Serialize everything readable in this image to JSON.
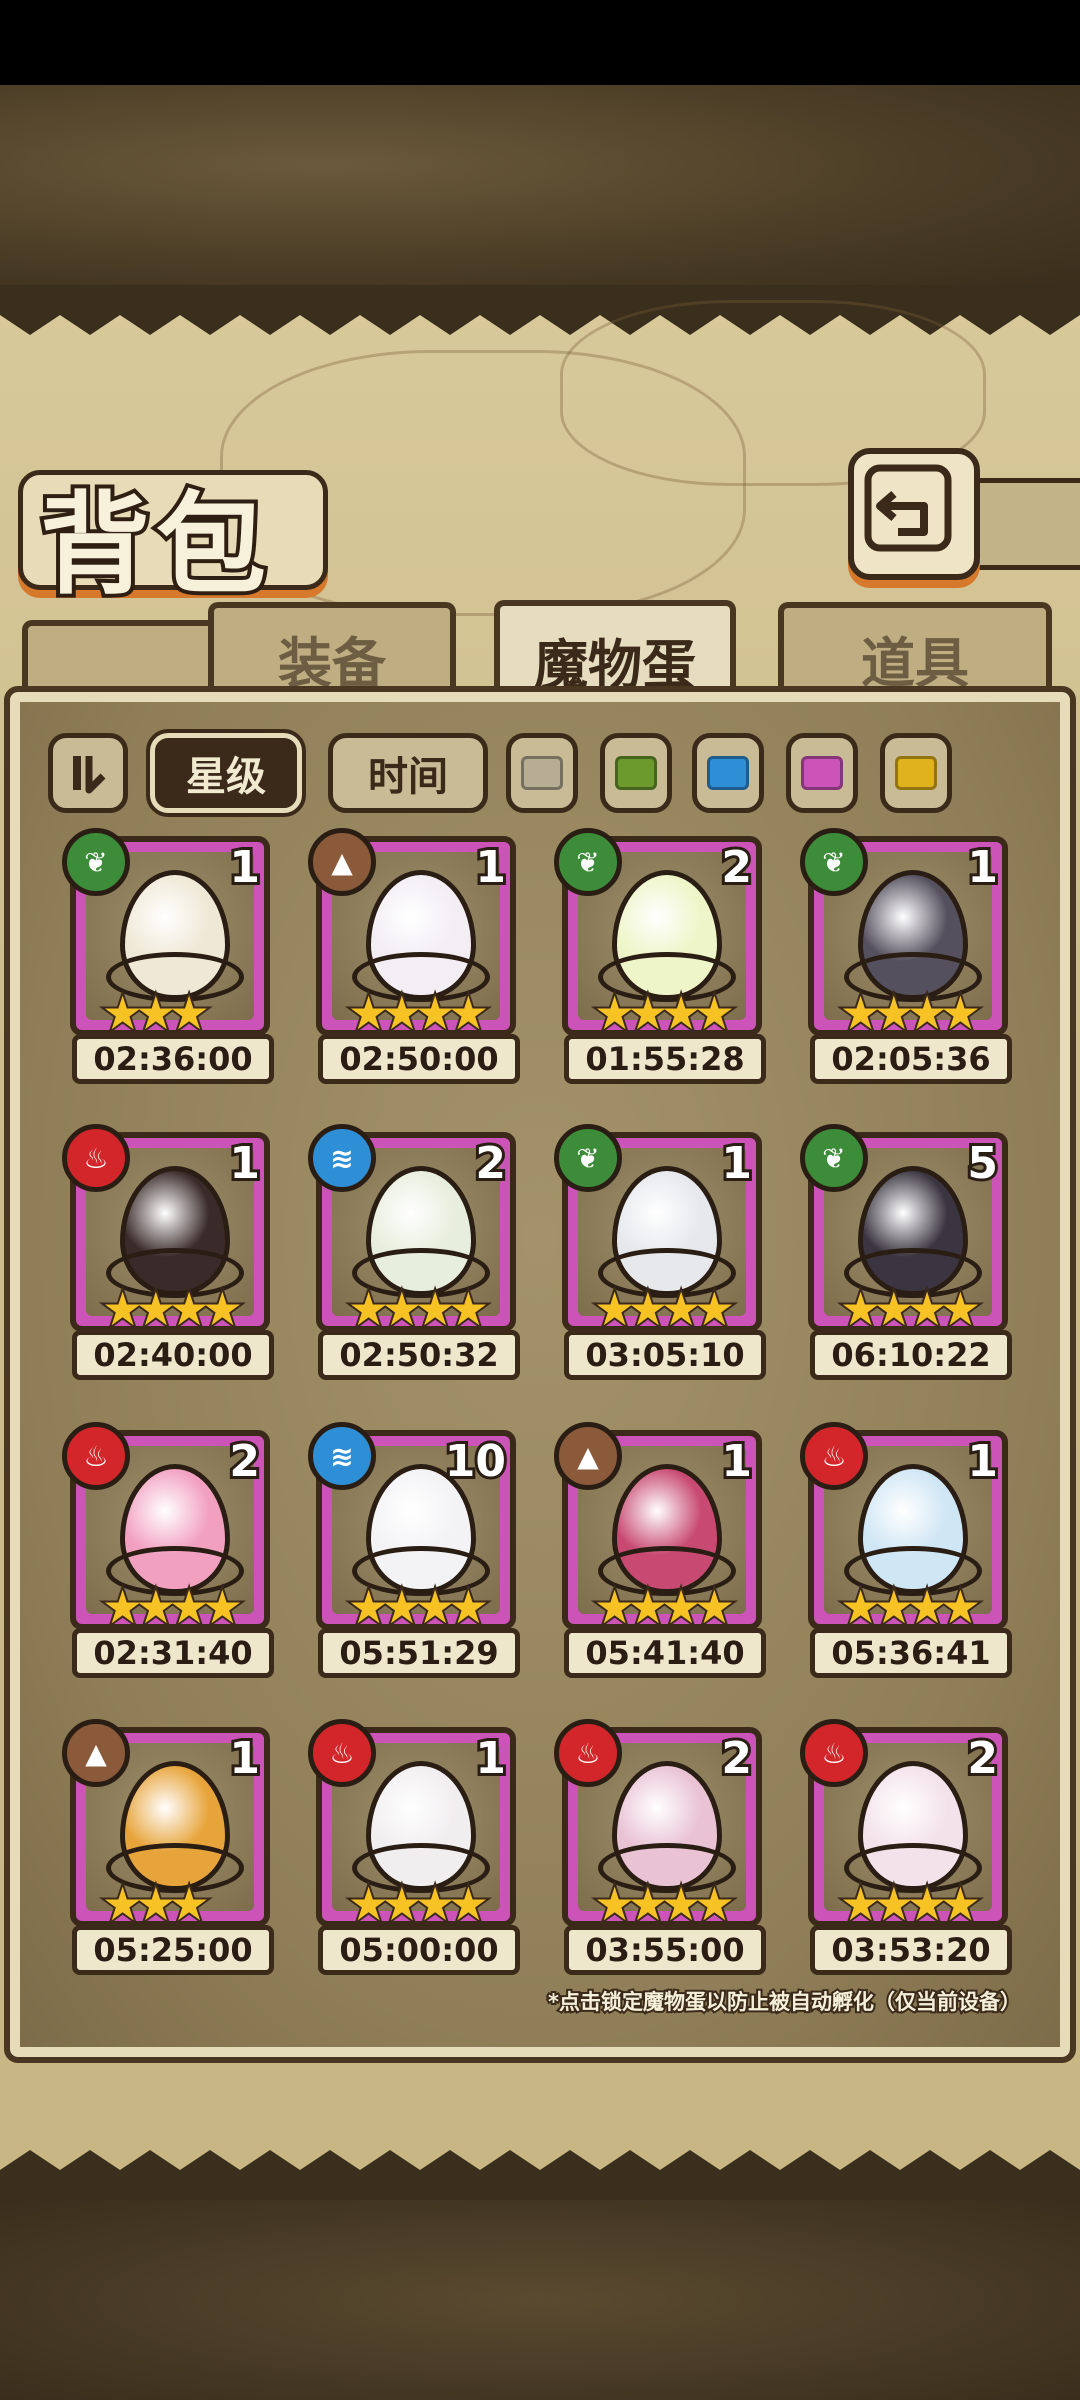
{
  "title": "背包",
  "tabs": [
    {
      "label": "装备",
      "active": false
    },
    {
      "label": "魔物蛋",
      "active": true
    },
    {
      "label": "道具",
      "active": false
    }
  ],
  "filters": {
    "sort_icon": "sort-toggle-icon",
    "star_label": "星级",
    "time_label": "时间",
    "colors": [
      "#b7ad95",
      "#6c9a2d",
      "#2f8fd6",
      "#cc53b8",
      "#e0b21b"
    ]
  },
  "eggs": [
    {
      "element": "leaf",
      "count": "1",
      "time": "02:36:00",
      "egg_color": "#efe8d6",
      "stars": "★★★"
    },
    {
      "element": "earth",
      "count": "1",
      "time": "02:50:00",
      "egg_color": "#f2eef4",
      "stars": "★★★★"
    },
    {
      "element": "leaf",
      "count": "2",
      "time": "01:55:28",
      "egg_color": "#eef5c8",
      "stars": "★★★★"
    },
    {
      "element": "leaf",
      "count": "1",
      "time": "02:05:36",
      "egg_color": "#55505e",
      "stars": "★★★★"
    },
    {
      "element": "fire",
      "count": "1",
      "time": "02:40:00",
      "egg_color": "#3a2a2a",
      "stars": "★★★★"
    },
    {
      "element": "water",
      "count": "2",
      "time": "02:50:32",
      "egg_color": "#e8eedd",
      "stars": "★★★★"
    },
    {
      "element": "leaf",
      "count": "1",
      "time": "03:05:10",
      "egg_color": "#e6e8ec",
      "stars": "★★★★"
    },
    {
      "element": "leaf",
      "count": "5",
      "time": "06:10:22",
      "egg_color": "#3a3540",
      "stars": "★★★★"
    },
    {
      "element": "fire",
      "count": "2",
      "time": "02:31:40",
      "egg_color": "#f2a0c0",
      "stars": "★★★★"
    },
    {
      "element": "water",
      "count": "10",
      "time": "05:51:29",
      "egg_color": "#f3f3f6",
      "stars": "★★★★"
    },
    {
      "element": "earth",
      "count": "1",
      "time": "05:41:40",
      "egg_color": "#c84a73",
      "stars": "★★★★"
    },
    {
      "element": "fire",
      "count": "1",
      "time": "05:36:41",
      "egg_color": "#cfe6f5",
      "stars": "★★★★"
    },
    {
      "element": "earth",
      "count": "1",
      "time": "05:25:00",
      "egg_color": "#e7a43a",
      "stars": "★★★"
    },
    {
      "element": "fire",
      "count": "1",
      "time": "05:00:00",
      "egg_color": "#f1eef0",
      "stars": "★★★★"
    },
    {
      "element": "fire",
      "count": "2",
      "time": "03:55:00",
      "egg_color": "#e9c2d4",
      "stars": "★★★★"
    },
    {
      "element": "fire",
      "count": "2",
      "time": "03:53:20",
      "egg_color": "#f3e2ea",
      "stars": "★★★★"
    }
  ],
  "hint": "*点击锁定魔物蛋以防止被自动孵化（仅当前设备）"
}
